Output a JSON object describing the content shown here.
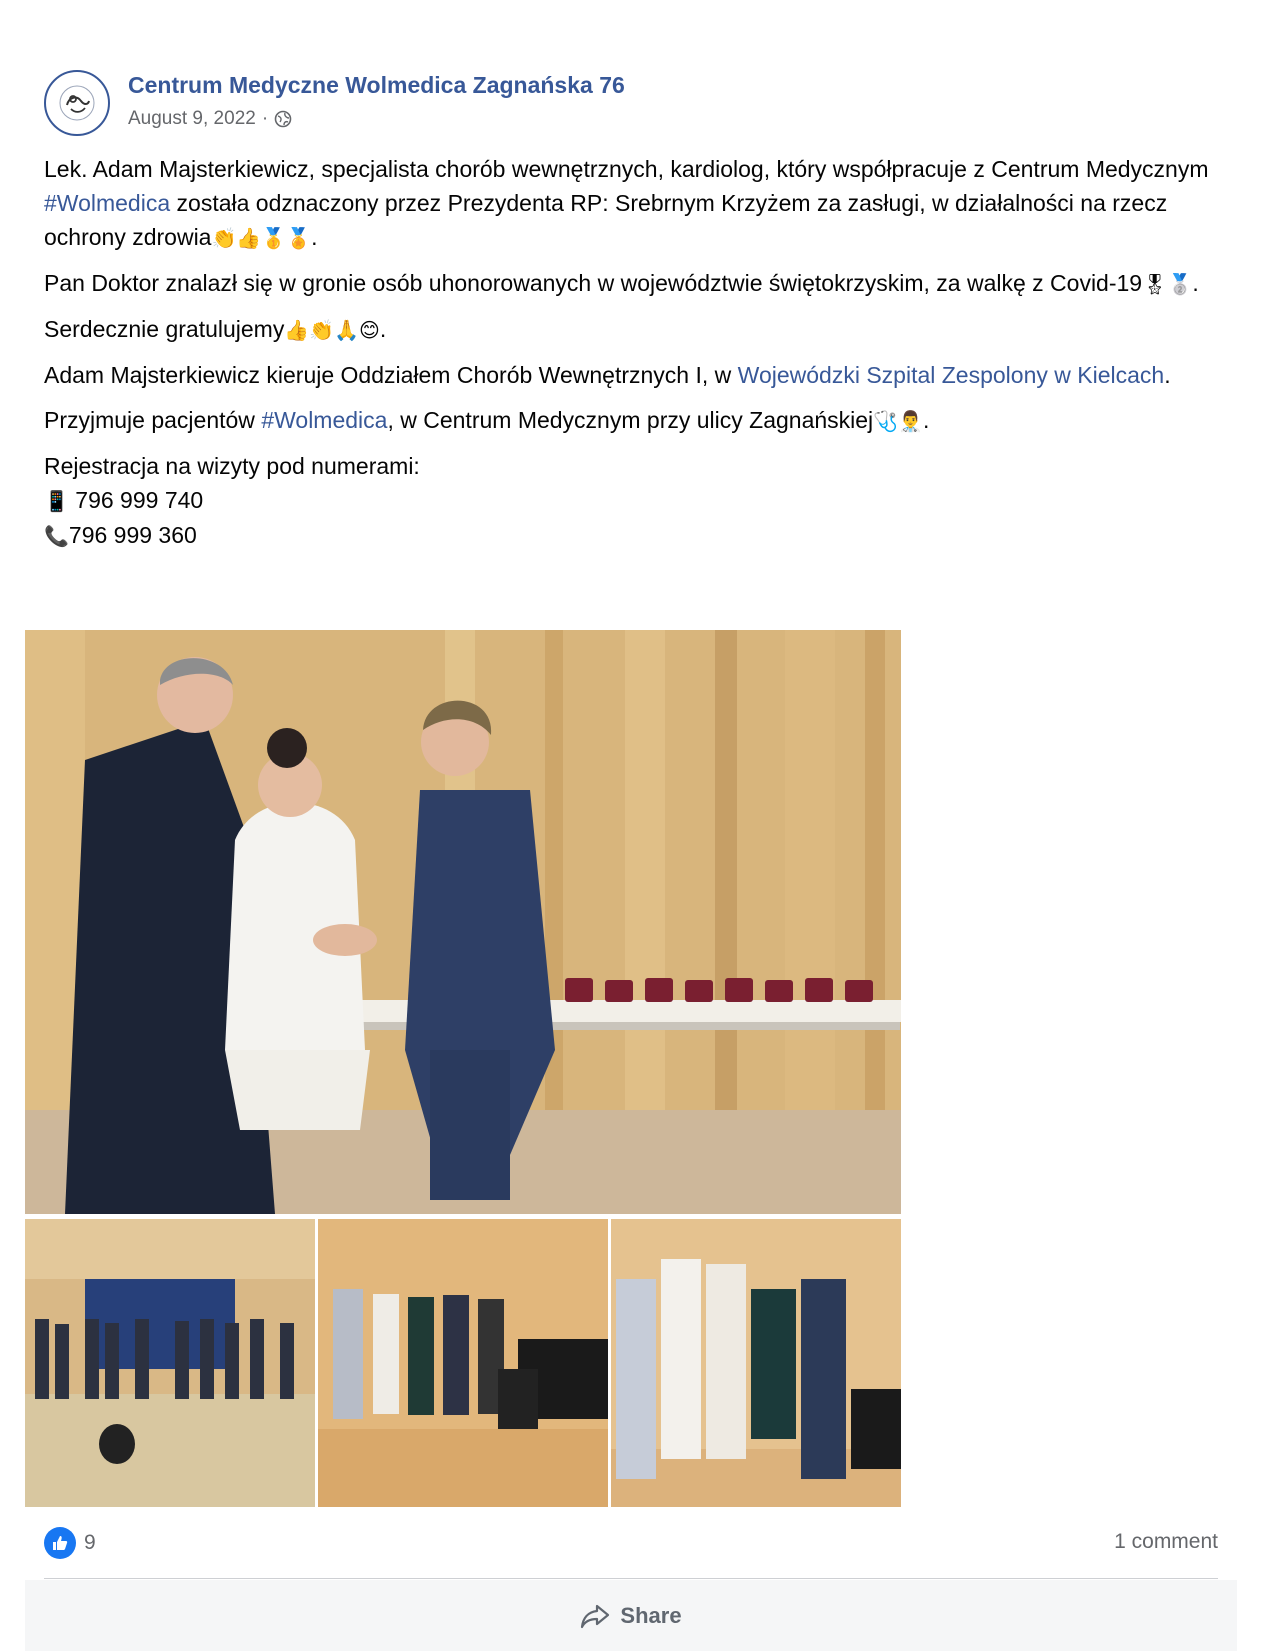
{
  "header": {
    "page_name": "Centrum Medyczne Wolmedica Zagnańska 76",
    "date": "August 9, 2022",
    "separator": "·",
    "privacy_icon": "globe-icon"
  },
  "body": {
    "p1_a": "Lek. Adam Majsterkiewicz, specjalista chorób wewnętrznych, kardiolog, który współpracuje z Centrum Medycznym ",
    "p1_hashtag": "#Wolmedica",
    "p1_b": " została odznaczony przez Prezydenta RP: Srebrnym Krzyżem za zasługi, w działalności na rzecz ochrony zdrowia",
    "p1_emoji": "👏👍🥇🏅",
    "p1_end": ".",
    "p2_a": "Pan Doktor znalazł się w gronie osób uhonorowanych w województwie świętokrzyskim, za walkę z Covid-19",
    "p2_emoji": "🎖🥈",
    "p2_end": ".",
    "p3_a": "Serdecznie gratulujemy",
    "p3_emoji": "👍👏🙏😊",
    "p3_end": ".",
    "p4_a": "Adam Majsterkiewicz kieruje Oddziałem Chorób Wewnętrznych I, w ",
    "p4_link": "Wojewódzki Szpital Zespolony w Kielcach",
    "p4_end": ".",
    "p5_a": "Przyjmuje pacjentów ",
    "p5_hashtag": "#Wolmedica",
    "p5_b": ", w Centrum Medycznym przy ulicy Zagnańskiej",
    "p5_emoji": "🩺👨‍⚕️",
    "p5_end": ".",
    "p6_line1": "Rejestracja na wizyty pod numerami:",
    "phone1_icon": "📱",
    "phone1": " 796 999 740",
    "phone2_icon": "📞",
    "phone2": "796 999 360"
  },
  "footer": {
    "like_count": "9",
    "comments": "1 comment",
    "share_label": "Share"
  },
  "colors": {
    "link": "#385898",
    "like_badge": "#1877f2",
    "muted": "#65676b"
  }
}
